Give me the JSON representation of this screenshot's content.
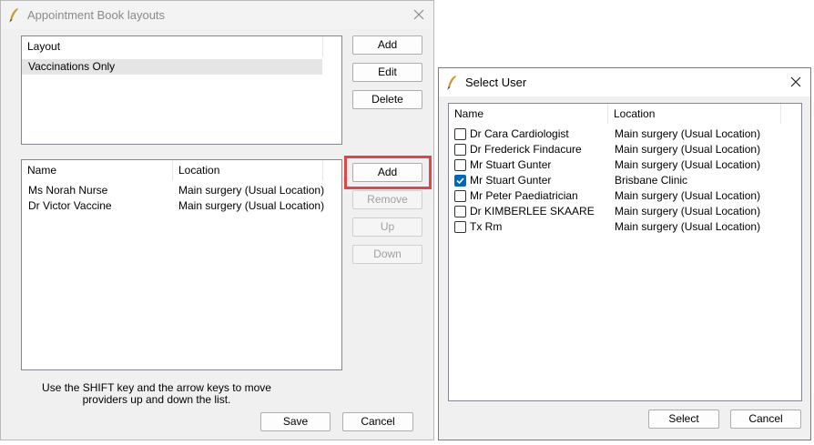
{
  "layouts_dialog": {
    "title": "Appointment Book layouts",
    "layout_list": {
      "header": "Layout",
      "items": [
        "Vaccinations Only"
      ]
    },
    "layout_buttons": {
      "add": "Add",
      "edit": "Edit",
      "delete": "Delete"
    },
    "provider_list": {
      "headers": {
        "name": "Name",
        "location": "Location"
      },
      "rows": [
        {
          "name": "Ms Norah Nurse",
          "location": "Main surgery (Usual Location)"
        },
        {
          "name": "Dr Victor Vaccine",
          "location": "Main surgery (Usual Location)"
        }
      ]
    },
    "provider_buttons": {
      "add": "Add",
      "remove": "Remove",
      "up": "Up",
      "down": "Down"
    },
    "hint_line1": "Use the SHIFT key and the arrow keys to move",
    "hint_line2": "providers up and down the list.",
    "save": "Save",
    "cancel": "Cancel"
  },
  "select_user_dialog": {
    "title": "Select User",
    "headers": {
      "name": "Name",
      "location": "Location"
    },
    "users": [
      {
        "name": "Dr Cara Cardiologist",
        "location": "Main surgery (Usual Location)",
        "checked": false
      },
      {
        "name": "Dr Frederick Findacure",
        "location": "Main surgery (Usual Location)",
        "checked": false
      },
      {
        "name": "Mr Stuart Gunter",
        "location": "Main surgery (Usual Location)",
        "checked": false
      },
      {
        "name": "Mr Stuart Gunter",
        "location": "Brisbane Clinic",
        "checked": true
      },
      {
        "name": "Mr Peter Paediatrician",
        "location": "Main surgery (Usual Location)",
        "checked": false
      },
      {
        "name": "Dr KIMBERLEE SKAARE",
        "location": "Main surgery (Usual Location)",
        "checked": false
      },
      {
        "name": "Tx Rm",
        "location": "Main surgery (Usual Location)",
        "checked": false
      }
    ],
    "select": "Select",
    "cancel": "Cancel"
  },
  "colors": {
    "highlight": "#e0454b",
    "checkbox_accent": "#0067c0",
    "selected_row": "#e5e5e5"
  },
  "icons": [
    "app-quill-icon",
    "close-icon",
    "checkbox-check-icon"
  ]
}
